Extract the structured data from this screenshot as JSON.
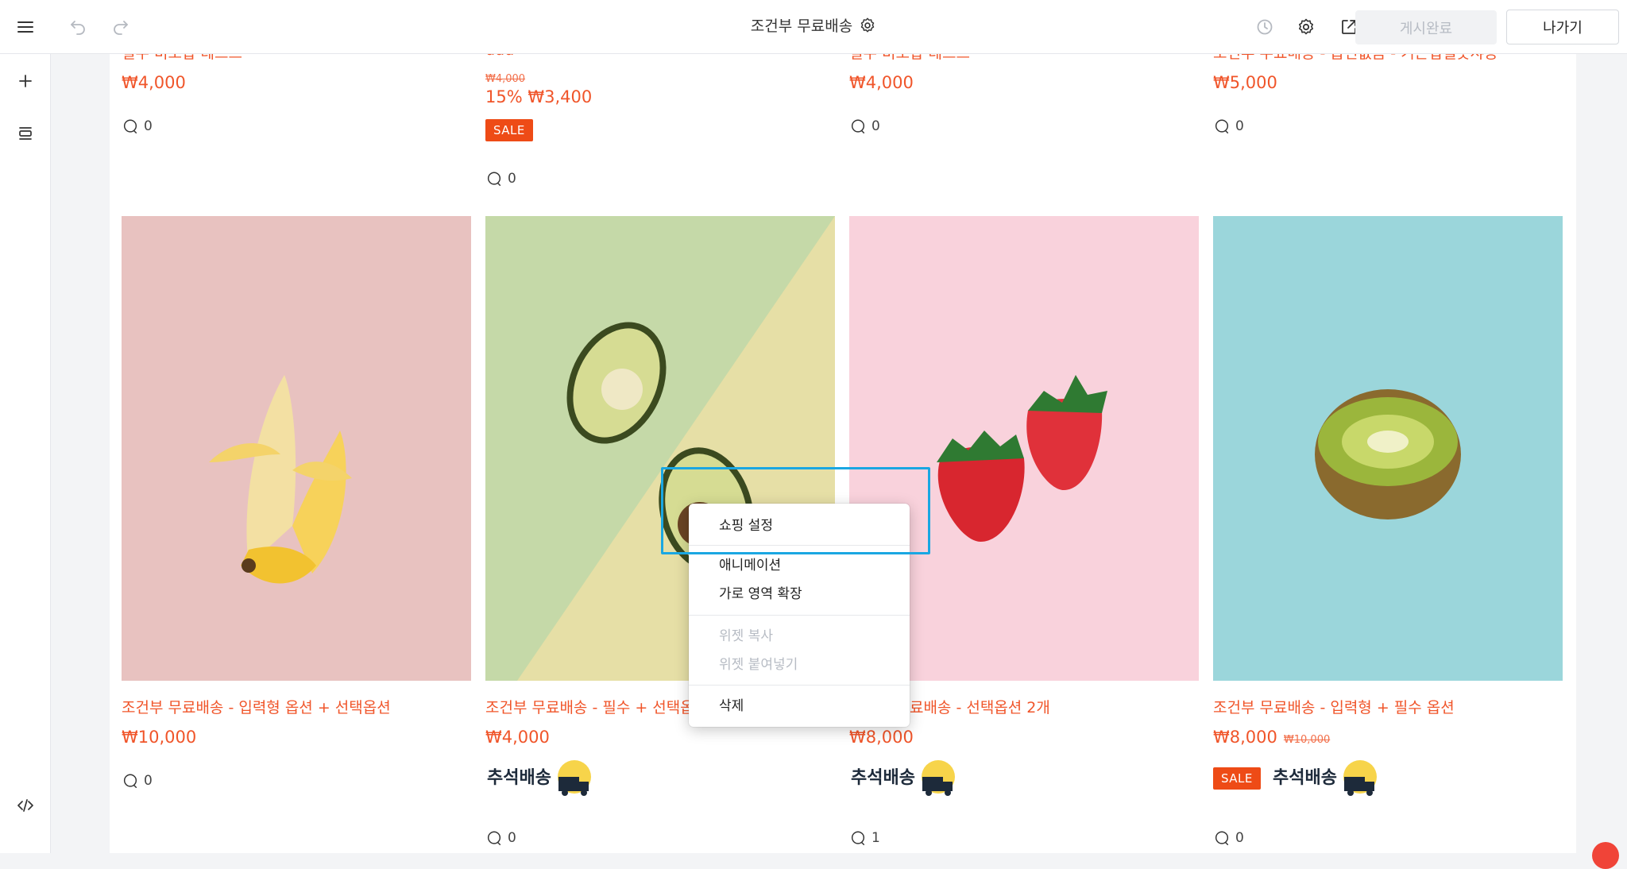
{
  "topbar": {
    "title": "조건부 무료배송",
    "publish_label": "게시완료",
    "exit_label": "나가기"
  },
  "products_top": [
    {
      "title": "필수 비조합 테스트",
      "price": "₩4,000"
    },
    {
      "title": "ddd",
      "old_price": "₩4,000",
      "price": "15% ₩3,400",
      "sale": "SALE"
    },
    {
      "title": "필수 비조합 테스트",
      "price": "₩4,000"
    },
    {
      "title": "조건부 무료배송 - 옵션없음 - 기존엽셀옷샤등",
      "price": "₩5,000"
    }
  ],
  "comments_top": [
    "0",
    "0",
    "0",
    "0"
  ],
  "products": [
    {
      "title": "조건부 무료배송 - 입력형 옵션 + 선택옵션",
      "price": "₩10,000",
      "comments": "0",
      "bg": "#e8c2c0"
    },
    {
      "title": "조건부 무료배송 - 필수 + 선택옵션",
      "price": "₩4,000",
      "badge": "추석배송",
      "comments": "0",
      "bg": "#c5d9a8"
    },
    {
      "title": "조건부 무료배송 - 선택옵션 2개",
      "price": "₩8,000",
      "badge": "추석배송",
      "comments": "1",
      "bg": "#f9d2dc"
    },
    {
      "title": "조건부 무료배송 - 입력형 + 필수 옵션",
      "price": "₩8,000",
      "old_price": "₩10,000",
      "sale": "SALE",
      "badge": "추석배송",
      "comments": "0",
      "bg": "#9bd6db"
    }
  ],
  "context_menu": {
    "items": [
      "쇼핑 설정",
      "애니메이션",
      "가로 영역 확장",
      "위젯 복사",
      "위젯 붙여넣기",
      "삭제"
    ]
  },
  "colors": {
    "accent": "#f0552a",
    "sale": "#ee4b16",
    "highlight": "#1aa7e2"
  }
}
